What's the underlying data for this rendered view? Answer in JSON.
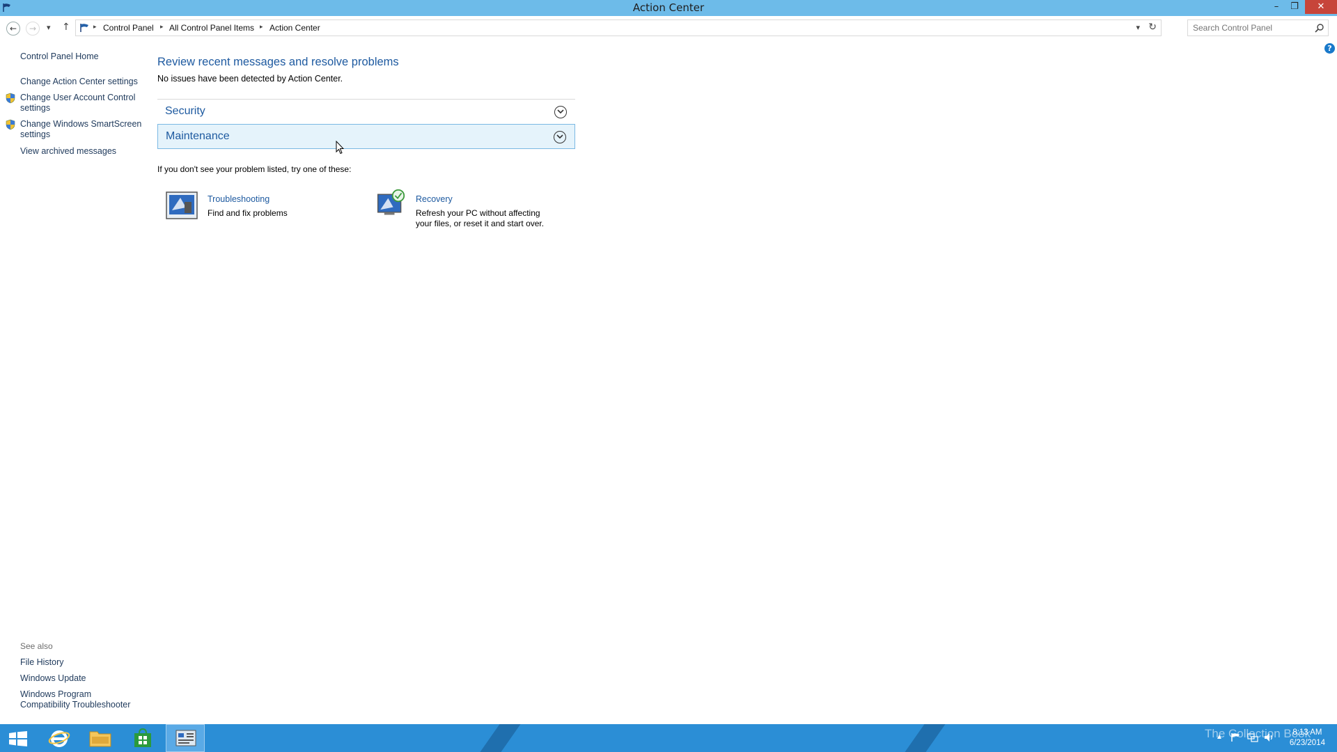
{
  "window": {
    "title": "Action Center",
    "controls": {
      "minimize": "–",
      "maximize": "❐",
      "close": "✕"
    }
  },
  "nav": {
    "back_icon": "←",
    "forward_icon": "→",
    "recent_icon": "▾",
    "up_icon": "↑",
    "breadcrumb": [
      "Control Panel",
      "All Control Panel Items",
      "Action Center"
    ],
    "search_placeholder": "Search Control Panel"
  },
  "sidebar": {
    "home": "Control Panel Home",
    "links": [
      {
        "label": "Change Action Center settings",
        "icon": "none"
      },
      {
        "label": "Change User Account Control settings",
        "icon": "uac-shield-icon"
      },
      {
        "label": "Change Windows SmartScreen settings",
        "icon": "uac-shield-icon"
      },
      {
        "label": "View archived messages",
        "icon": "none"
      }
    ],
    "see_also_title": "See also",
    "see_also": [
      "File History",
      "Windows Update",
      "Windows Program Compatibility Troubleshooter"
    ]
  },
  "main": {
    "title": "Review recent messages and resolve problems",
    "subtitle": "No issues have been detected by Action Center.",
    "sections": [
      "Security",
      "Maintenance"
    ],
    "hint": "If you don't see your problem listed, try one of these:",
    "tiles": [
      {
        "title": "Troubleshooting",
        "description": "Find and fix problems"
      },
      {
        "title": "Recovery",
        "description": "Refresh your PC without affecting your files, or reset it and start over."
      }
    ],
    "help_icon": "?"
  },
  "taskbar": {
    "items": [
      "start-button",
      "internet-explorer",
      "file-explorer",
      "store",
      "control-panel"
    ],
    "watermark": "The Collection Book",
    "time": "8:13 AM",
    "date": "6/23/2014"
  },
  "colors": {
    "titlebar": "#6dbbe9",
    "link": "#1e5aa0",
    "taskbar": "#2b8ed6",
    "close": "#c7453a"
  }
}
